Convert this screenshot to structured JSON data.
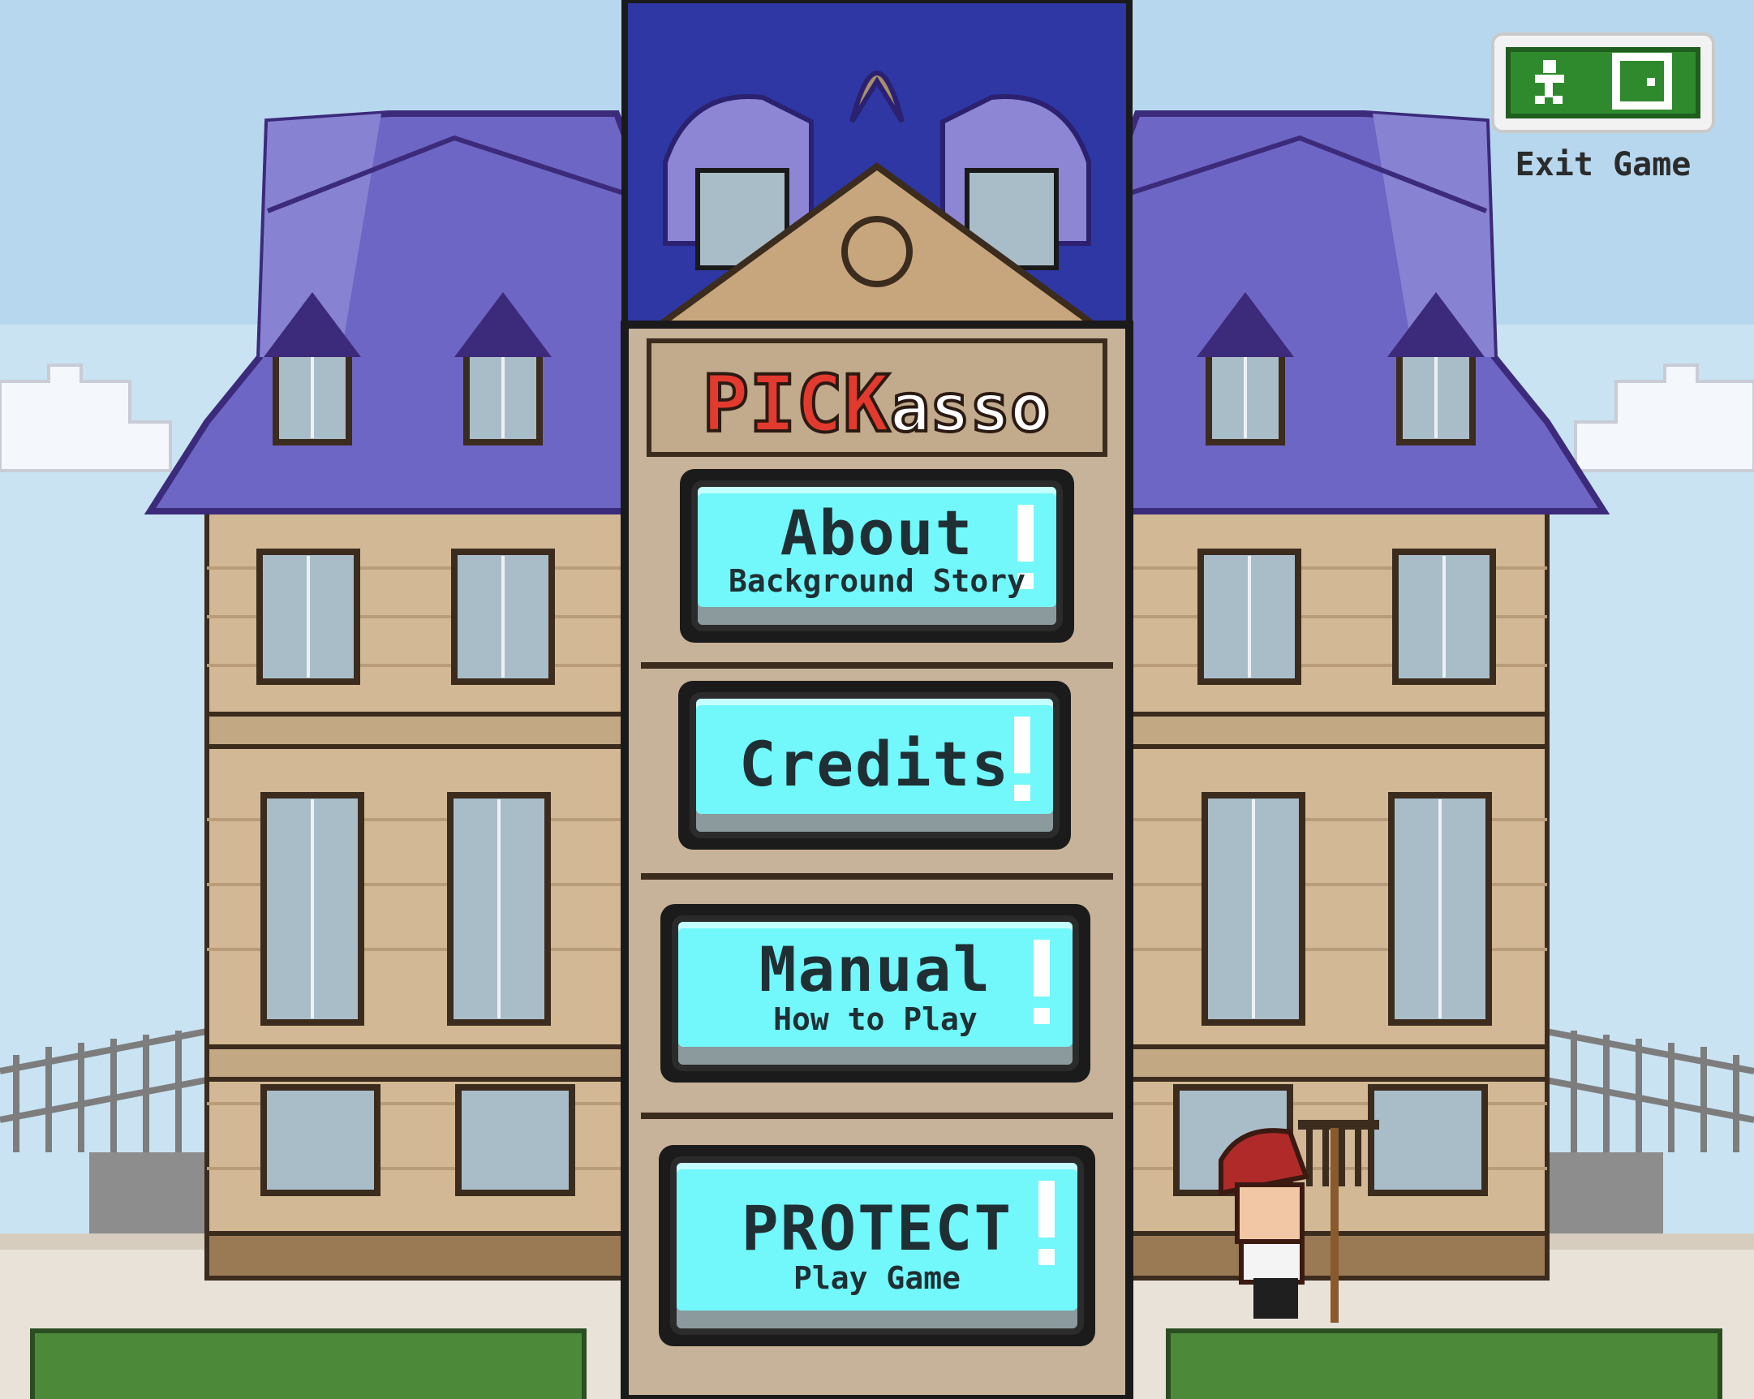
{
  "game": {
    "logo_bold": "PICK",
    "logo_rest": "asso"
  },
  "menu": {
    "about": {
      "main": "About",
      "sub": "Background Story"
    },
    "credits": {
      "main": "Credits"
    },
    "manual": {
      "main": "Manual",
      "sub": "How to Play"
    },
    "protect": {
      "main": "PROTECT",
      "sub": "Play Game"
    }
  },
  "exit": {
    "label": "Exit Game",
    "icon": "exit-door-icon"
  },
  "colors": {
    "sky": "#c9e3f3",
    "roof": "#6e66c4",
    "wall": "#d2b894",
    "button_face": "#72f7fb",
    "exit_green": "#2f8a2e",
    "logo_red": "#e23a2e"
  }
}
